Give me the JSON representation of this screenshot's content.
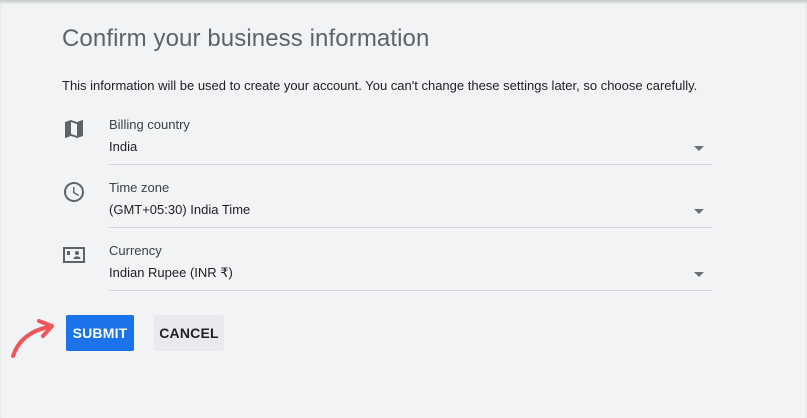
{
  "page": {
    "title": "Confirm your business information",
    "description": "This information will be used to create your account. You can't change these settings later, so choose carefully."
  },
  "fields": {
    "billing_country": {
      "icon": "map-icon",
      "label": "Billing country",
      "value": "India"
    },
    "time_zone": {
      "icon": "clock-icon",
      "label": "Time zone",
      "value": "(GMT+05:30) India Time"
    },
    "currency": {
      "icon": "currency-icon",
      "label": "Currency",
      "value": "Indian Rupee (INR ₹)"
    }
  },
  "actions": {
    "submit_label": "SUBMIT",
    "cancel_label": "CANCEL"
  },
  "colors": {
    "background": "#f1f3f4",
    "primary": "#1a73e8",
    "annotation_arrow": "#f0555a"
  }
}
